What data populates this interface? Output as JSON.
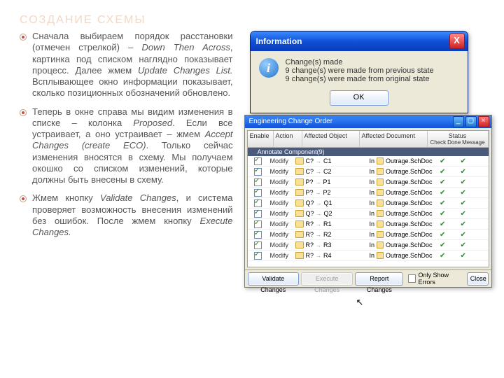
{
  "title": "СОЗДАНИЕ СХЕМЫ",
  "bullets": [
    {
      "pre": "Сначала выбираем порядок расстановки (отмечен стрелкой) – ",
      "i1": "Down Then Across",
      "mid1": ", картинка под списком наглядно показывает процесс. Далее жмем ",
      "i2": "Update Changes List.",
      "mid2": " Всплывающее окно информации показывает, сколько позиционных обозначений обновлено."
    },
    {
      "pre": "Теперь в окне справа мы видим изменения в списке – колонка ",
      "i1": "Proposed",
      "mid1": ". Если все устраивает, а оно устраивает – жмем ",
      "i2": "Accept Changes (create ECO)",
      "mid2": ". Только сейчас изменения вносятся в схему. Мы получаем окошко со списком изменений, которые должны быть внесены в схему."
    },
    {
      "pre": "Жмем кнопку ",
      "i1": "Validate Changes",
      "mid1": ", и система проверяет возможность внесения изменений без ошибок. После жмем кнопку ",
      "i2": "Execute Changes.",
      "mid2": ""
    }
  ],
  "dialog": {
    "title": "Information",
    "close": "X",
    "lines": [
      "Change(s) made",
      "9 change(s) were made from previous state",
      "9 change(s) were made from original state"
    ],
    "ok": "OK"
  },
  "eco": {
    "title": "Engineering Change Order",
    "headers": {
      "enable": "Enable",
      "action": "Action",
      "object": "Affected Object",
      "doc": "Affected Document",
      "status": "Status",
      "check": "Check",
      "done": "Done",
      "msg": "Message"
    },
    "group": "Annotate Component(9)",
    "modify": "Modify",
    "in": "In",
    "doc": "Outrage.SchDoc",
    "rows": [
      {
        "f": "C?",
        "t": "C1"
      },
      {
        "f": "C?",
        "t": "C2"
      },
      {
        "f": "P?",
        "t": "P1"
      },
      {
        "f": "P?",
        "t": "P2"
      },
      {
        "f": "Q?",
        "t": "Q1"
      },
      {
        "f": "Q?",
        "t": "Q2"
      },
      {
        "f": "R?",
        "t": "R1"
      },
      {
        "f": "R?",
        "t": "R2"
      },
      {
        "f": "R?",
        "t": "R3"
      },
      {
        "f": "R?",
        "t": "R4"
      }
    ],
    "footer": {
      "validate": "Validate Changes",
      "execute": "Execute Changes",
      "report": "Report Changes",
      "only": "Only Show Errors",
      "close": "Close"
    }
  }
}
